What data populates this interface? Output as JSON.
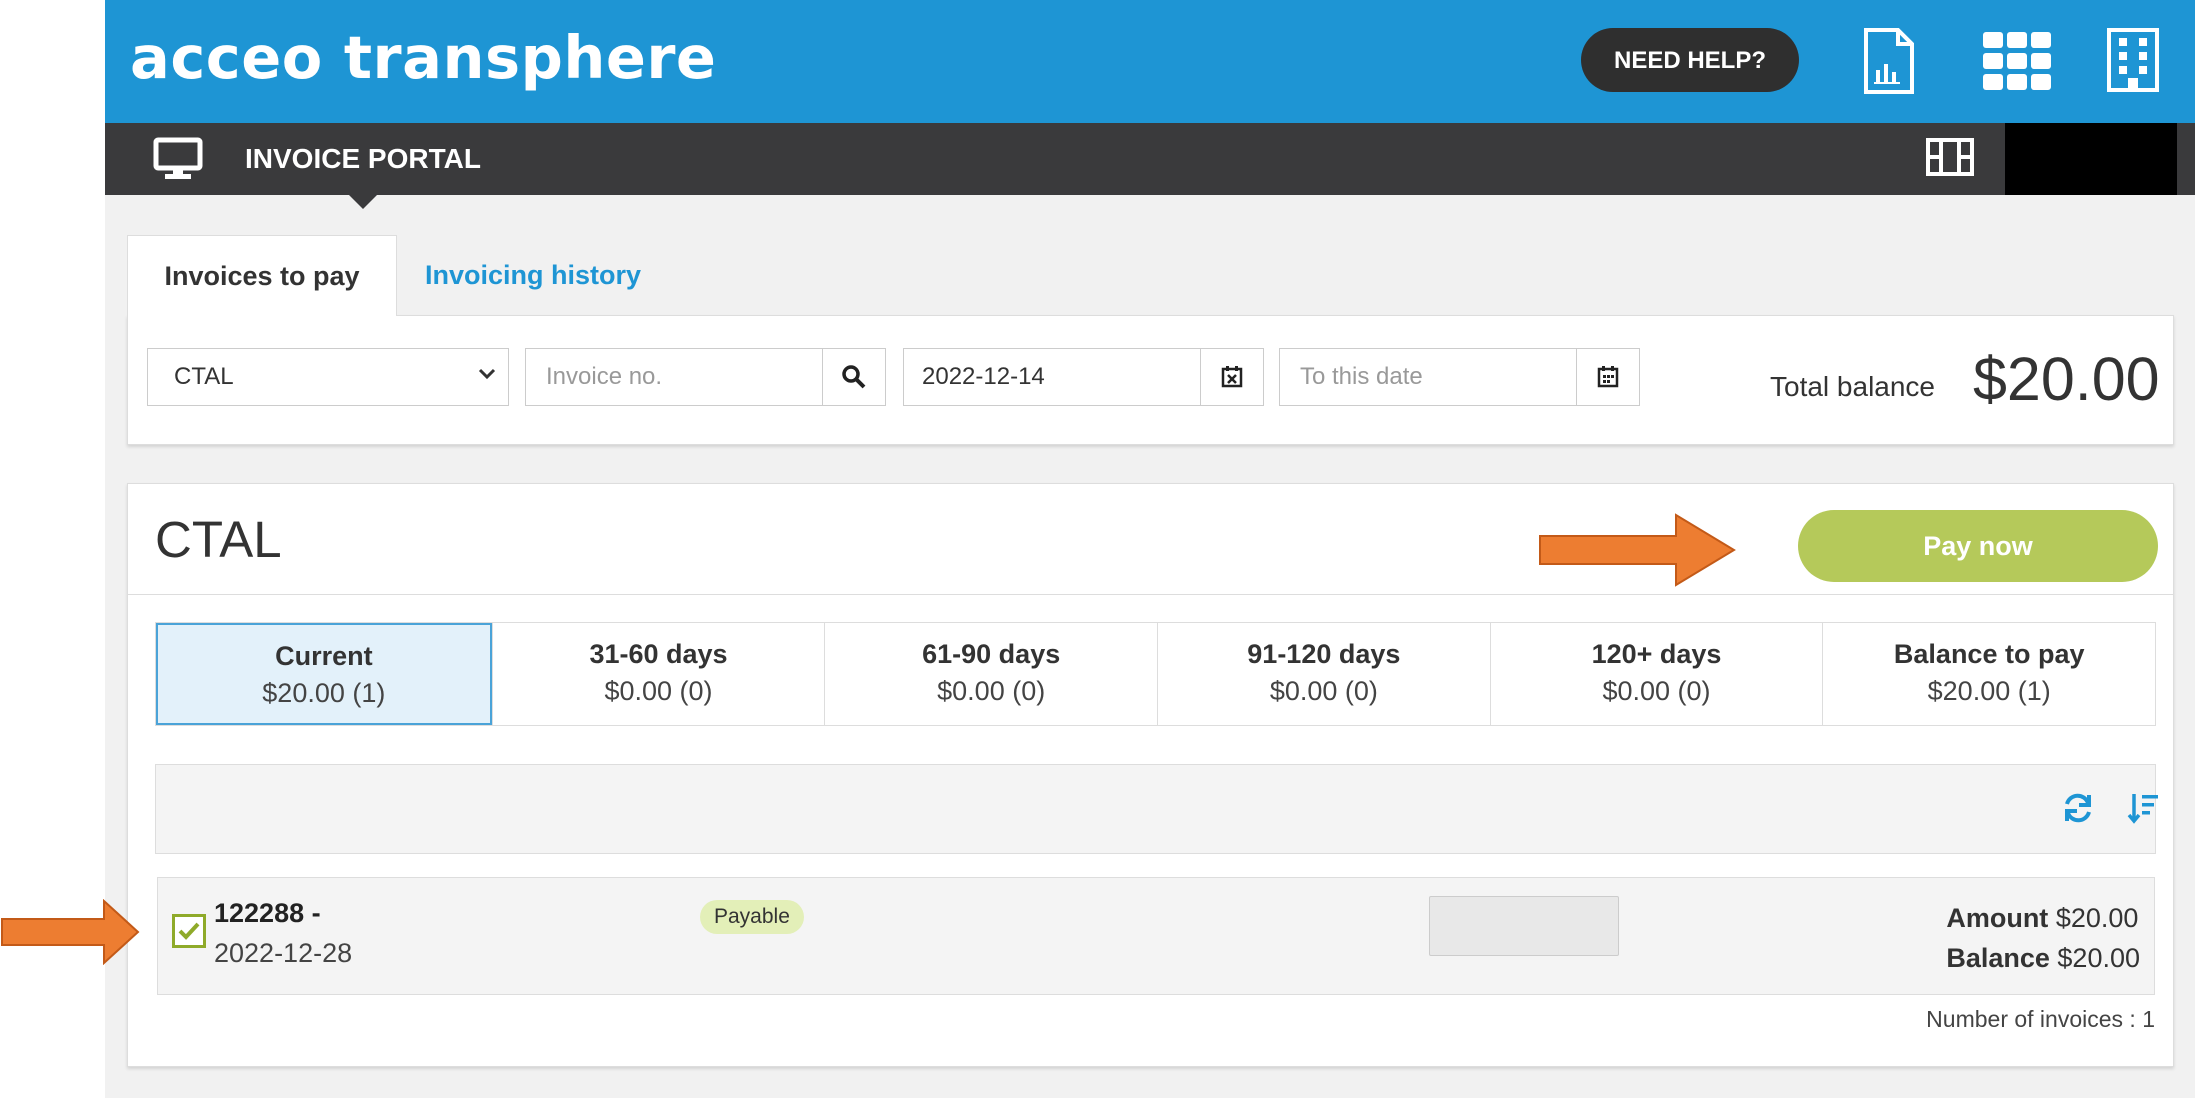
{
  "header": {
    "logo": "acceo transphere",
    "help_label": "NEED HELP?",
    "icons": [
      "report-document-icon",
      "grid-apps-icon",
      "building-icon"
    ],
    "portal_title": "INVOICE PORTAL"
  },
  "tabs": [
    {
      "label": "Invoices to pay",
      "active": true
    },
    {
      "label": "Invoicing history",
      "active": false
    }
  ],
  "filters": {
    "account_select": "CTAL",
    "invoice_placeholder": "Invoice no.",
    "from_date": "2022-12-14",
    "to_date_placeholder": "To this date",
    "total_balance_label": "Total balance",
    "total_balance_value": "$20.00"
  },
  "account": {
    "name": "CTAL",
    "pay_label": "Pay now",
    "aging": [
      {
        "label": "Current",
        "value": "$20.00 (1)"
      },
      {
        "label": "31-60 days",
        "value": "$0.00 (0)"
      },
      {
        "label": "61-90 days",
        "value": "$0.00 (0)"
      },
      {
        "label": "91-120 days",
        "value": "$0.00 (0)"
      },
      {
        "label": "120+ days",
        "value": "$0.00 (0)"
      },
      {
        "label": "Balance to pay",
        "value": "$20.00 (1)"
      }
    ],
    "invoice": {
      "number": "122288 -",
      "date": "2022-12-28",
      "status": "Payable",
      "amount_label": "Amount",
      "amount": "$20.00",
      "balance_label": "Balance",
      "balance": "$20.00",
      "checked": true
    },
    "count_text": "Number of invoices : 1"
  },
  "colors": {
    "header_blue": "#1e95d4",
    "portal_bar": "#3a3a3c",
    "pay_green": "#b5c95a",
    "annotation_orange": "#ed7d31"
  }
}
